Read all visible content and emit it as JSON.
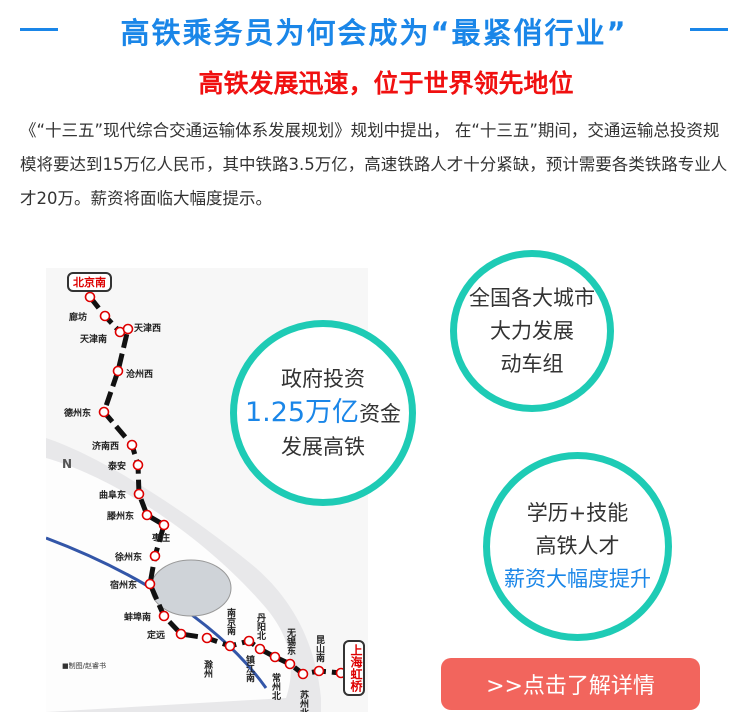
{
  "header": {
    "title": "高铁乘务员为何会成为“最紧俏行业”",
    "subtitle": "高铁发展迅速，位于世界领先地位"
  },
  "intro": "《“十三五”现代综合交通运输体系发展规划》规划中提出， 在“十三五”期间，交通运输总投资规模将要达到15万亿人民币，其中铁路3.5万亿，高速铁路人才十分紧缺，预计需要各类铁路专业人才20万。薪资将面临大幅度提示。",
  "map": {
    "start": "北京南",
    "end": "上海虹桥",
    "north": "N",
    "credit": "■制图/赵睿书",
    "stations": [
      "廊坊",
      "天津南",
      "天津西",
      "沧州西",
      "德州东",
      "济南西",
      "泰安",
      "曲阜东",
      "滕州东",
      "枣庄",
      "徐州东",
      "宿州东",
      "蚌埠南",
      "定远",
      "滁州",
      "南京南",
      "镇江南",
      "丹阳北",
      "常州北",
      "无锡东",
      "苏州北",
      "昆山南"
    ]
  },
  "circles": {
    "gov": {
      "line1": "政府投资",
      "amount": "1.25万亿",
      "amount_suffix": "资金",
      "line3": "发展高铁"
    },
    "cities": {
      "line1": "全国各大城市",
      "line2": "大力发展",
      "line3": "动车组"
    },
    "talent": {
      "line1": "学历+技能",
      "line2": "高铁人才",
      "line3": "薪资大幅度提升"
    }
  },
  "cta": {
    "label": ">>点击了解详情"
  },
  "colors": {
    "accent": "#1a86e8",
    "red": "#f01010",
    "teal": "#1ecbb5",
    "button": "#f2655d"
  }
}
